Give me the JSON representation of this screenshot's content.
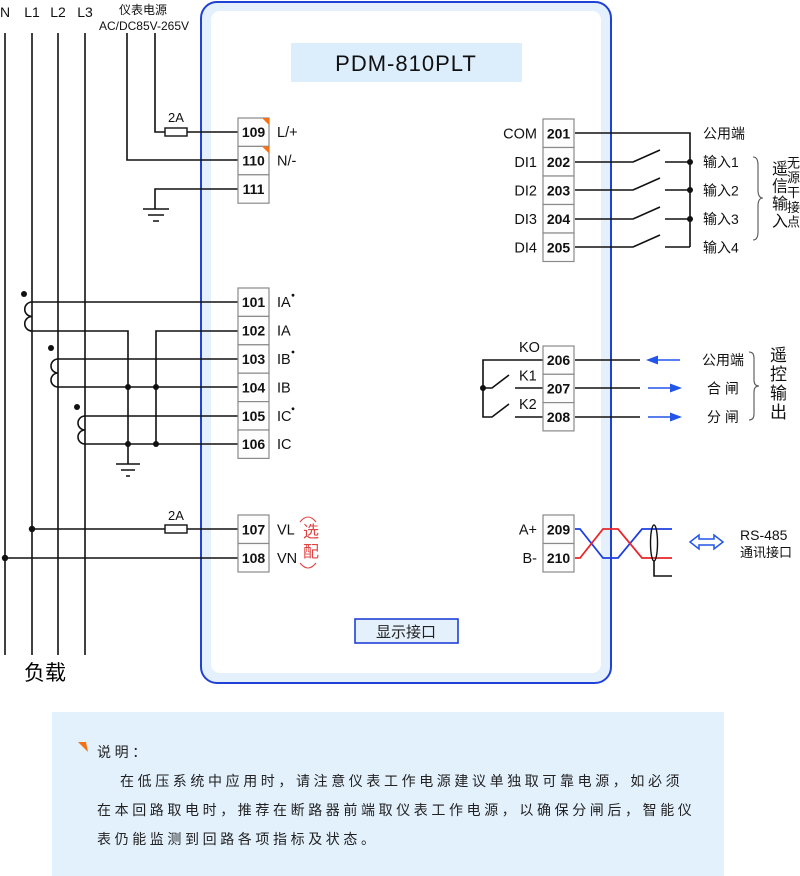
{
  "device": {
    "model": "PDM-810PLT",
    "display_port": "显示接口"
  },
  "mains": {
    "lines": [
      "N",
      "L1",
      "L2",
      "L3"
    ],
    "load_label": "负载"
  },
  "power_supply": {
    "title": "仪表电源",
    "range": "AC/DC85V-265V",
    "fuse": "2A",
    "terminals": [
      {
        "num": "109",
        "label": "L/+",
        "flag": true
      },
      {
        "num": "110",
        "label": "N/-",
        "flag": true
      },
      {
        "num": "111",
        "label": ""
      }
    ]
  },
  "current_inputs": {
    "terminals": [
      {
        "num": "101",
        "label": "IA",
        "polarity": true
      },
      {
        "num": "102",
        "label": "IA"
      },
      {
        "num": "103",
        "label": "IB",
        "polarity": true
      },
      {
        "num": "104",
        "label": "IB"
      },
      {
        "num": "105",
        "label": "IC",
        "polarity": true
      },
      {
        "num": "106",
        "label": "IC"
      }
    ]
  },
  "voltage_inputs": {
    "fuse": "2A",
    "optional_note": "选配",
    "terminals": [
      {
        "num": "107",
        "label": "VL"
      },
      {
        "num": "108",
        "label": "VN"
      }
    ]
  },
  "digital_inputs": {
    "group_title": "遥信输入",
    "group_subtitle": "无源干接点",
    "terminals": [
      {
        "num": "201",
        "label": "COM",
        "desc": "公用端"
      },
      {
        "num": "202",
        "label": "DI1",
        "desc": "输入1"
      },
      {
        "num": "203",
        "label": "DI2",
        "desc": "输入2"
      },
      {
        "num": "204",
        "label": "DI3",
        "desc": "输入3"
      },
      {
        "num": "205",
        "label": "DI4",
        "desc": "输入4"
      }
    ]
  },
  "relay_outputs": {
    "group_title": "遥控输出",
    "terminals": [
      {
        "num": "206",
        "label": "KO",
        "desc": "公用端",
        "signal": "incoming"
      },
      {
        "num": "207",
        "label": "K1",
        "desc": "合 闸",
        "signal": "outgoing"
      },
      {
        "num": "208",
        "label": "K2",
        "desc": "分 闸",
        "signal": "outgoing"
      }
    ]
  },
  "rs485": {
    "title": "RS-485",
    "subtitle": "通讯接口",
    "terminals": [
      {
        "num": "209",
        "label": "A+"
      },
      {
        "num": "210",
        "label": "B-"
      }
    ]
  },
  "note": {
    "heading": "说明：",
    "lines": [
      "在低压系统中应用时，请注意仪表工作电源建议单独取可靠电源，如必须",
      "在本回路取电时，推荐在断路器前端取仪表工作电源，以确保分闸后，智能仪",
      "表仍能监测到回路各项指标及状态。"
    ]
  },
  "colors": {
    "frame": "#2041d6",
    "frame_band": "#e4f0fc",
    "title_bg": "#dcedfc",
    "note_bg": "#e3f1fd",
    "accent": "#f47216",
    "wire_a": "#1e3fe0",
    "wire_b": "#e8262a",
    "arrow": "#2255e8",
    "optional": "#e04444"
  }
}
